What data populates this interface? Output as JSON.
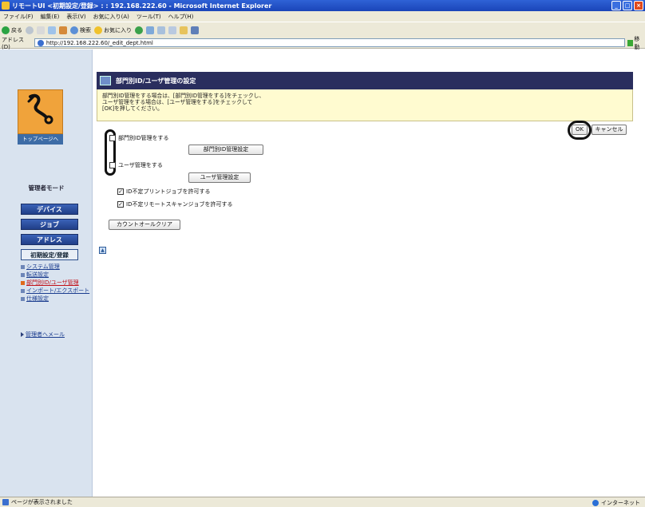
{
  "window": {
    "title": "リモートUI <初期設定/登録> : : 192.168.222.60 - Microsoft Internet Explorer",
    "buttons": [
      "_",
      "□",
      "×"
    ]
  },
  "menu": [
    "ファイル(F)",
    "編集(E)",
    "表示(V)",
    "お気に入り(A)",
    "ツール(T)",
    "ヘルプ(H)"
  ],
  "toolbar": {
    "back": "戻る",
    "search": "検索",
    "favorites": "お気に入り"
  },
  "address": {
    "label": "アドレス(D)",
    "url": "http://192.168.222.60/_edit_dept.html",
    "go": "移動"
  },
  "sidebar": {
    "top_page": "トップページへ",
    "mode": "管理者モード",
    "nav": [
      "デバイス",
      "ジョブ",
      "アドレス",
      "初期設定/登録"
    ],
    "sub_items": [
      "システム管理",
      "転送設定",
      "部門別ID/ユーザ管理",
      "インポート/エクスポート",
      "仕様設定"
    ],
    "admin_mail": "管理者へメール"
  },
  "main": {
    "header_title": "部門別ID/ユーザ管理の設定",
    "info_lines": [
      "部門別ID管理をする場合は、[部門別ID管理をする]をチェックし、",
      "ユーザ管理をする場合は、[ユーザ管理をする]をチェックして",
      "[OK]を押してください。"
    ],
    "ok": "OK",
    "cancel": "キャンセル",
    "dept_check_label": "部門別ID管理をする",
    "dept_settings_button": "部門別ID管理設定",
    "user_check_label": "ユーザ管理をする",
    "user_settings_button": "ユーザ管理設定",
    "allow_print_label": "ID不定プリントジョブを許可する",
    "allow_scan_label": "ID不定リモートスキャンジョブを許可する",
    "count_clear_button": "カウントオールクリア"
  },
  "status": {
    "left": "ページが表示されました",
    "zone": "インターネット"
  }
}
